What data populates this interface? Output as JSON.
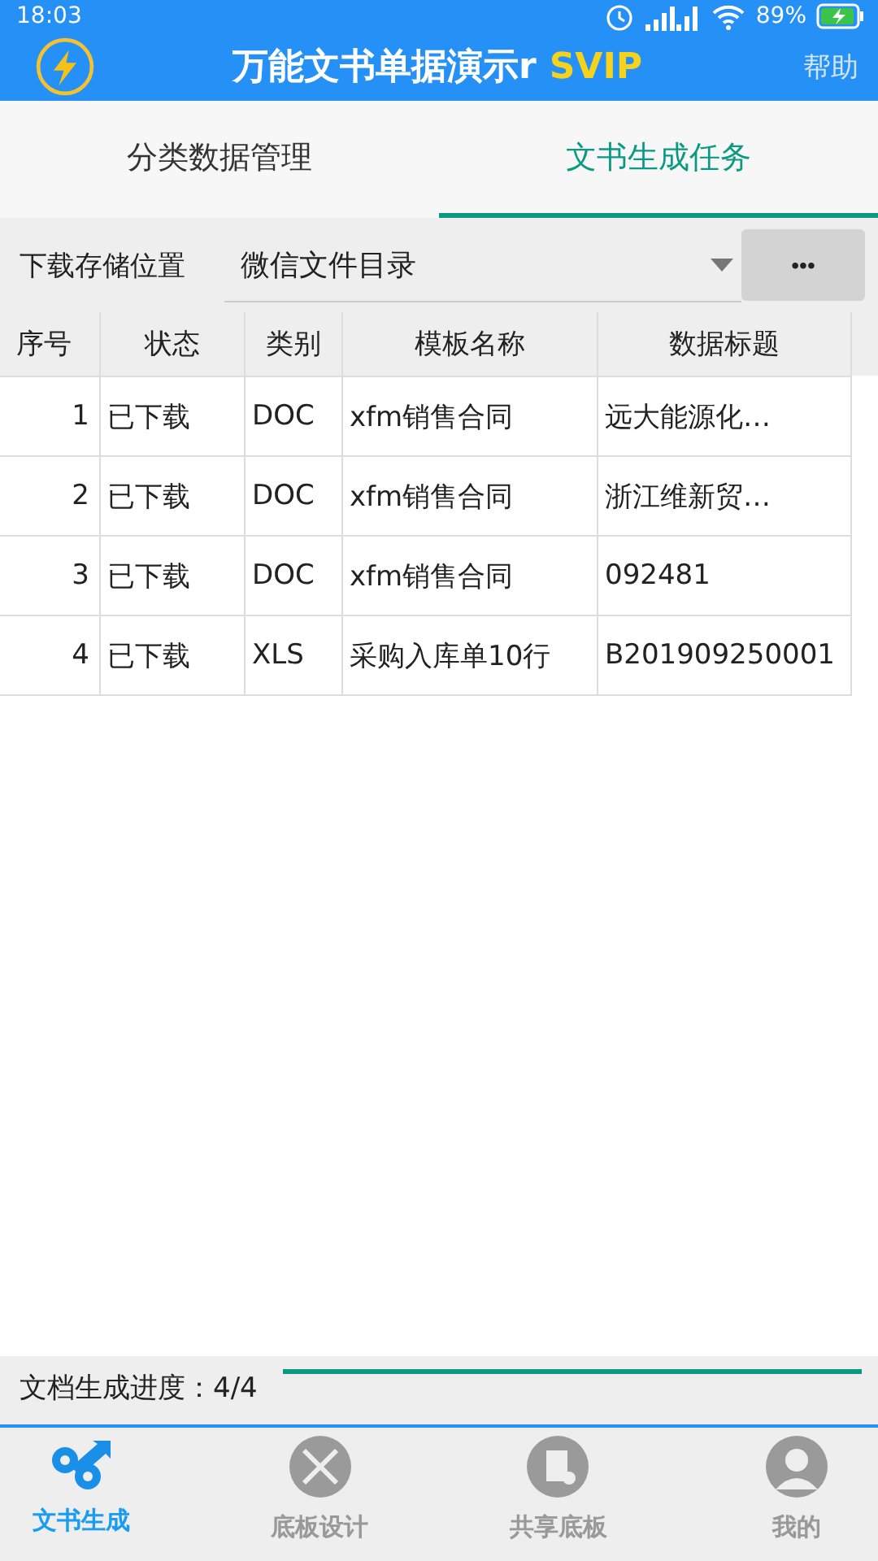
{
  "status_bar": {
    "time": "18:03",
    "battery": "89%"
  },
  "header": {
    "title": "万能文书单据演示r",
    "badge": "SVIP",
    "help": "帮助"
  },
  "tabs": [
    {
      "label": "分类数据管理",
      "selected": false
    },
    {
      "label": "文书生成任务",
      "selected": true
    }
  ],
  "storage": {
    "label": "下载存储位置",
    "value": "微信文件目录",
    "more": "•••"
  },
  "table": {
    "columns": [
      "序号",
      "状态",
      "类别",
      "模板名称",
      "数据标题"
    ],
    "rows": [
      [
        "1",
        "已下载",
        "DOC",
        "xfm销售合同",
        "远大能源化…"
      ],
      [
        "2",
        "已下载",
        "DOC",
        "xfm销售合同",
        "浙江维新贸…"
      ],
      [
        "3",
        "已下载",
        "DOC",
        "xfm销售合同",
        "092481"
      ],
      [
        "4",
        "已下载",
        "XLS",
        "采购入库单10行",
        "B201909250001"
      ]
    ]
  },
  "progress": {
    "label": "文档生成进度：4/4"
  },
  "nav": [
    {
      "label": "文书生成",
      "selected": true
    },
    {
      "label": "底板设计",
      "selected": false
    },
    {
      "label": "共享底板",
      "selected": false
    },
    {
      "label": "我的",
      "selected": false
    }
  ]
}
